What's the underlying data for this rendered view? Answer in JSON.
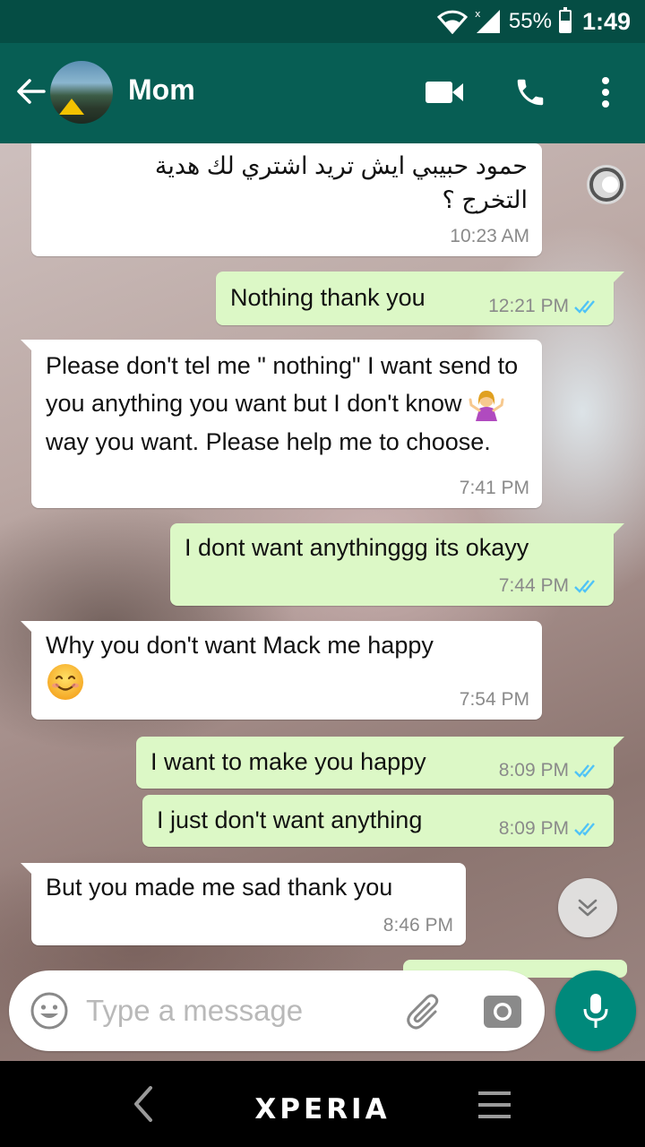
{
  "status_bar": {
    "battery_percent": "55%",
    "battery_level": 0.55,
    "time": "1:49",
    "icons": [
      "wifi-icon",
      "signal-icon",
      "battery-icon"
    ]
  },
  "header": {
    "contact_name": "Mom",
    "icons": [
      "back-arrow-icon",
      "video-call-icon",
      "phone-icon",
      "more-options-icon"
    ]
  },
  "messages": [
    {
      "direction": "in",
      "text": "حمود حبيبي ايش تريد اشتري لك هدية التخرج ؟",
      "time": "10:23 AM"
    },
    {
      "direction": "out",
      "text": "Nothing thank you",
      "time": "12:21 PM",
      "read": true
    },
    {
      "direction": "in",
      "text_part1": "Please don't tel me \" nothing\" I want send to you anything you want but I don't know",
      "emoji": "person-shrugging-emoji",
      "text_part2": "way you want.  Please help me to choose.",
      "time": "7:41 PM"
    },
    {
      "direction": "out",
      "text": "I dont want anythinggg its okayy",
      "time": "7:44 PM",
      "read": true
    },
    {
      "direction": "in",
      "text": "Why you don't want Mack me happy",
      "emoji": "smiling-face-emoji",
      "time": "7:54 PM"
    },
    {
      "direction": "out",
      "text": "I want to make you happy",
      "time": "8:09 PM",
      "read": true
    },
    {
      "direction": "out",
      "text": "I just don't want anything",
      "time": "8:09 PM",
      "read": true
    },
    {
      "direction": "in",
      "text": "But you made me sad thank you",
      "time": "8:46 PM"
    }
  ],
  "composer": {
    "placeholder": "Type a message",
    "value": ""
  },
  "navbar": {
    "brand": "XPERIA"
  },
  "colors": {
    "header": "#075e54",
    "status_bar": "#054d44",
    "outgoing_bubble": "#dcf8c6",
    "incoming_bubble": "#ffffff",
    "mic_button": "#00897b",
    "read_ticks": "#4fc3f7"
  }
}
